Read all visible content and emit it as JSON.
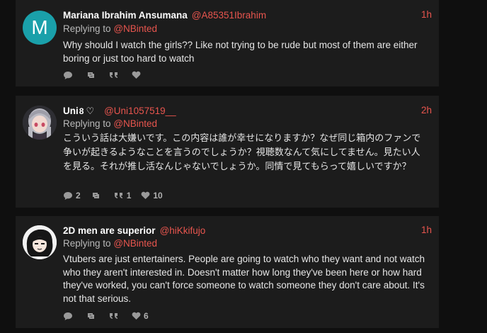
{
  "replies": [
    {
      "name": "Mariana Ibrahim Ansumana",
      "handle": "@A85351Ibrahim",
      "time": "1h",
      "replying_prefix": "Replying to",
      "replying_to": "@NBinted",
      "avatar_letter": "M",
      "text": "Why should I watch the girls?? Like not trying to be rude but most of them are either boring or just too hard to watch",
      "counts": {
        "reply": "",
        "retweet": "",
        "quote": "",
        "like": ""
      }
    },
    {
      "name": "Uni",
      "name_emoji": "♡",
      "handle": "@Uni1057519__",
      "time": "2h",
      "replying_prefix": "Replying to",
      "replying_to": "@NBinted",
      "text": "こういう話は大嫌いです。この内容は誰が幸せになりますか？なぜ同じ箱内のファンで争いが起きるようなことを言うのでしょうか？視聴数なんて気にしてません。見たい人を見る。それが推し活なんじゃないでしょうか。同情で見てもらって嬉しいですか？",
      "counts": {
        "reply": "2",
        "retweet": "",
        "quote": "1",
        "like": "10"
      }
    },
    {
      "name": "2D men are superior",
      "handle": "@hiKkifujo",
      "time": "1h",
      "replying_prefix": "Replying to",
      "replying_to": "@NBinted",
      "text": "Vtubers are just entertainers. People are going to watch who they want and not watch who they aren't interested in. Doesn't matter how long they've been here or how hard they've worked, you can't force someone to watch someone they don't care about. It's not that serious.",
      "counts": {
        "reply": "",
        "retweet": "",
        "quote": "",
        "like": "6"
      }
    }
  ],
  "colors": {
    "background": "#0f0f0f",
    "card": "#1c1c1c",
    "accent": "#e8554e",
    "avatar_teal": "#1aa0aa"
  }
}
